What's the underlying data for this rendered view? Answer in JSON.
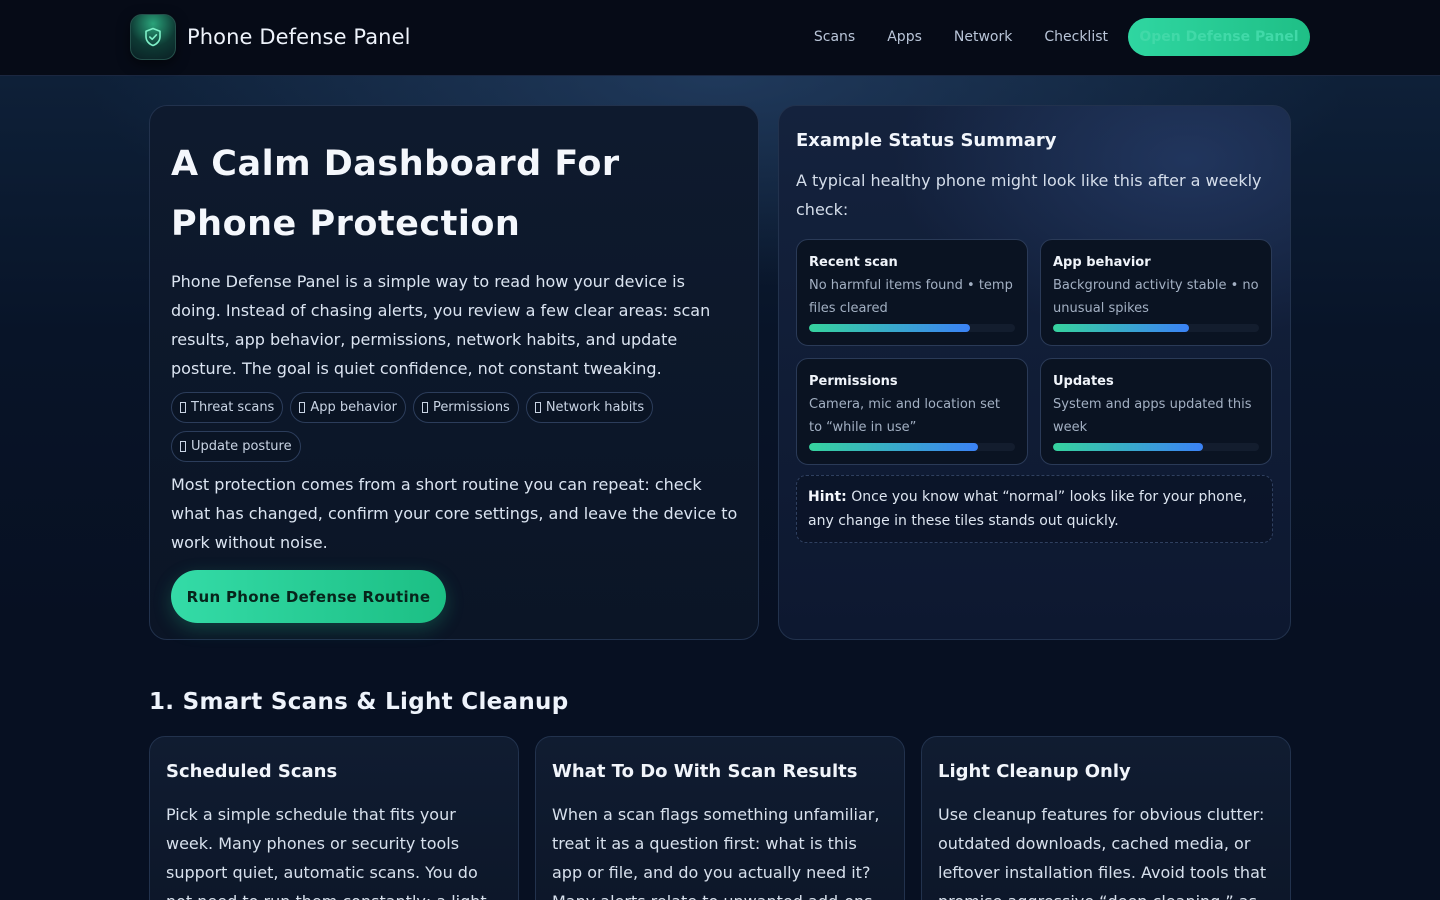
{
  "header": {
    "brand": "Phone Defense Panel",
    "logo_icon": "shield-check-icon",
    "nav": [
      "Scans",
      "Apps",
      "Network",
      "Checklist"
    ],
    "cta_label": "Open Defense Panel"
  },
  "hero": {
    "title": "A Calm Dashboard For Phone Protection",
    "intro": "Phone Defense Panel is a simple way to read how your device is doing. Instead of chasing alerts, you review a few clear areas: scan results, app behavior, permissions, network habits, and update posture. The goal is quiet confidence, not constant tweaking.",
    "chips": [
      "Threat scans",
      "App behavior",
      "Permissions",
      "Network habits",
      "Update posture"
    ],
    "outro": "Most protection comes from a short routine you can repeat: check what has changed, confirm your core settings, and leave the device to work without noise.",
    "button_label": "Run Phone Defense Routine"
  },
  "status": {
    "title": "Example Status Summary",
    "lead": "A typical healthy phone might look like this after a weekly check:",
    "tiles": [
      {
        "title": "Recent scan",
        "desc": "No harmful items found • temp files cleared",
        "level": 0.78
      },
      {
        "title": "App behavior",
        "desc": "Background activity stable • no unusual spikes",
        "level": 0.66
      },
      {
        "title": "Permissions",
        "desc": "Camera, mic and location set to “while in use”",
        "level": 0.82
      },
      {
        "title": "Updates",
        "desc": "System and apps updated this week",
        "level": 0.73
      }
    ],
    "hint_label": "Hint:",
    "hint_text": "Once you know what “normal” looks like for your phone, any change in these tiles stands out quickly."
  },
  "section1": {
    "title": "1. Smart Scans & Light Cleanup",
    "cards": [
      {
        "title": "Scheduled Scans",
        "text": "Pick a simple schedule that fits your week. Many phones or security tools support quiet, automatic scans. You do not need to run them constantly; a light"
      },
      {
        "title": "What To Do With Scan Results",
        "text": "When a scan flags something unfamiliar, treat it as a question first: what is this app or file, and do you actually need it? Many alerts relate to unwanted add-ons"
      },
      {
        "title": "Light Cleanup Only",
        "text": "Use cleanup features for obvious clutter: outdated downloads, cached media, or leftover installation files. Avoid tools that promise aggressive “deep cleaning,” as"
      }
    ]
  },
  "colors": {
    "accent": "#2fd6a1",
    "background": "#071022",
    "card": "#0e1a2e",
    "bar_end": "#3b82f6"
  }
}
